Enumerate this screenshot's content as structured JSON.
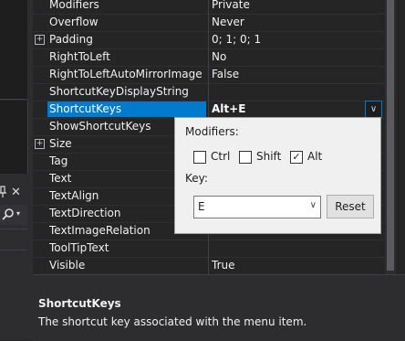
{
  "left_panel": {
    "pin_icon": "pin-icon",
    "close_glyph": "✕",
    "search_icon": "search-icon"
  },
  "properties": [
    {
      "name": "Modifiers",
      "value": "Private",
      "expandable": false
    },
    {
      "name": "Overflow",
      "value": "Never",
      "expandable": false
    },
    {
      "name": "Padding",
      "value": "0; 1; 0; 1",
      "expandable": true
    },
    {
      "name": "RightToLeft",
      "value": "No",
      "expandable": false
    },
    {
      "name": "RightToLeftAutoMirrorImage",
      "value": "False",
      "expandable": false
    },
    {
      "name": "ShortcutKeyDisplayString",
      "value": "",
      "expandable": false
    },
    {
      "name": "ShortcutKeys",
      "value": "Alt+E",
      "expandable": false,
      "selected": true
    },
    {
      "name": "ShowShortcutKeys",
      "value": "",
      "expandable": false
    },
    {
      "name": "Size",
      "value": "",
      "expandable": true
    },
    {
      "name": "Tag",
      "value": "",
      "expandable": false
    },
    {
      "name": "Text",
      "value": "",
      "expandable": false
    },
    {
      "name": "TextAlign",
      "value": "",
      "expandable": false
    },
    {
      "name": "TextDirection",
      "value": "",
      "expandable": false
    },
    {
      "name": "TextImageRelation",
      "value": "",
      "expandable": false
    },
    {
      "name": "ToolTipText",
      "value": "",
      "expandable": false
    },
    {
      "name": "Visible",
      "value": "True",
      "expandable": false
    }
  ],
  "expander_glyph": "+",
  "dropdown_glyph": "∨",
  "popup": {
    "modifiers_label": "Modifiers:",
    "ctrl_label": "Ctrl",
    "ctrl_checked": false,
    "shift_label": "Shift",
    "shift_checked": false,
    "alt_label": "Alt",
    "alt_checked": true,
    "check_glyph": "✓",
    "key_label": "Key:",
    "key_value": "E",
    "combo_arrow": "∨",
    "reset_label": "Reset"
  },
  "description": {
    "title": "ShortcutKeys",
    "text": "The shortcut key associated with the menu item."
  },
  "colors": {
    "selection": "#007acc",
    "background": "#252526",
    "popup_bg": "#f0f0f0"
  }
}
